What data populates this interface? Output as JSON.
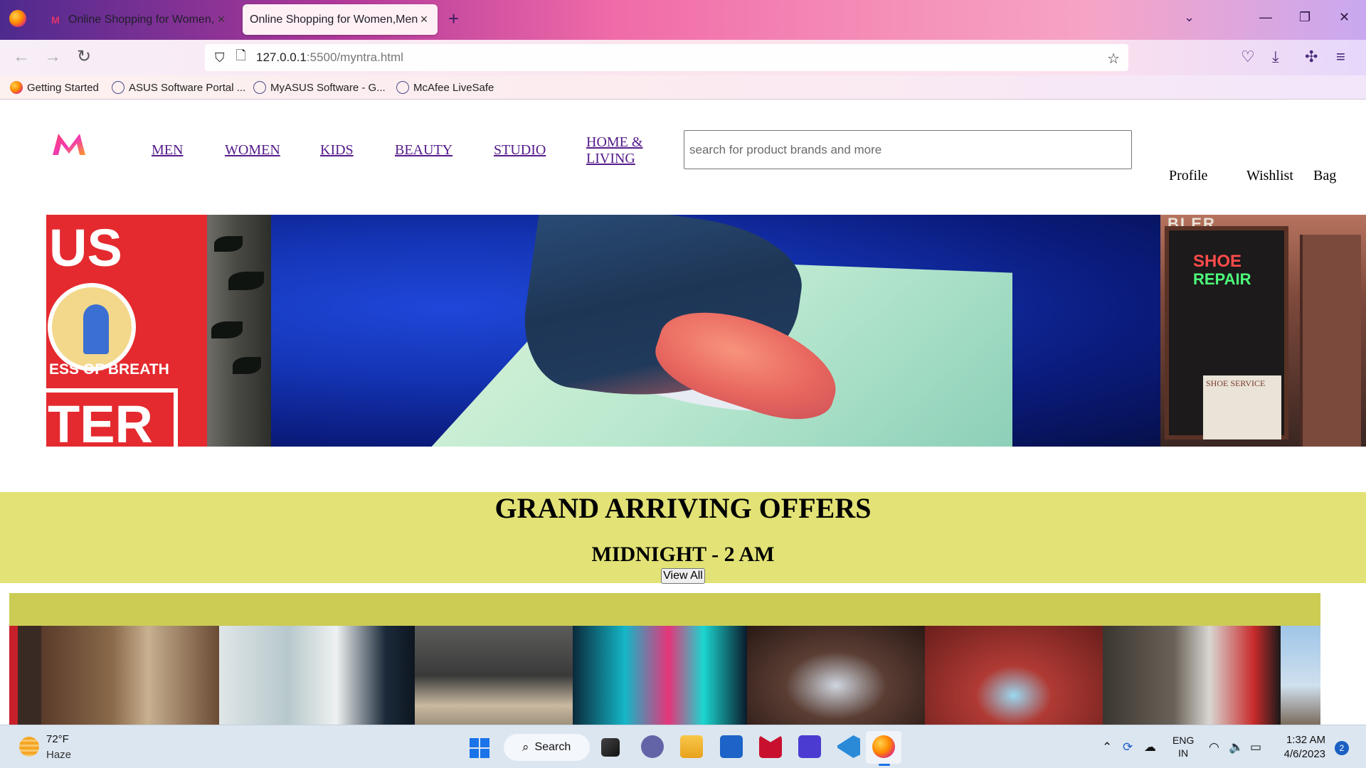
{
  "browser": {
    "tabs": [
      {
        "title": "Online Shopping for Women, M",
        "close": "×"
      },
      {
        "title": "Online Shopping for Women,Men,K",
        "close": "×"
      }
    ],
    "new_tab": "+",
    "list_tabs": "⌄",
    "window_controls": {
      "minimize": "—",
      "restore": "❐",
      "close": "✕"
    },
    "url": {
      "host": "127.0.0.1",
      "rest": ":5500/myntra.html"
    },
    "bookmarks": [
      "Getting Started",
      "ASUS Software Portal ...",
      "MyASUS Software - G...",
      "McAfee LiveSafe"
    ]
  },
  "site": {
    "nav": [
      "MEN",
      "WOMEN",
      "KIDS",
      "BEAUTY",
      "STUDIO",
      "HOME &",
      "LIVING"
    ],
    "search_placeholder": "search for product brands and more",
    "user_actions": {
      "profile": "Profile",
      "wishlist": "Wishlist",
      "bag": "Bag"
    },
    "hero": {
      "left_sign_top": "US",
      "left_sign_mid": "ESS OF BREATH",
      "left_sign_bottom": "TER",
      "right_neon_1": "SHOE",
      "right_neon_2": "REPAIR",
      "right_top": "BLER",
      "right_sign": "SHOE SERVICE"
    },
    "offers": {
      "title": "GRAND ARRIVING OFFERS",
      "subtitle": "MIDNIGHT - 2 AM",
      "button": "View All"
    },
    "brand_color": "#e3346b",
    "offer_band_color": "#e2e276"
  },
  "taskbar": {
    "weather": {
      "temp": "72°F",
      "condition": "Haze"
    },
    "search_label": "Search",
    "language": {
      "line1": "ENG",
      "line2": "IN"
    },
    "clock": {
      "time": "1:32 AM",
      "date": "4/6/2023"
    },
    "notifications": "2"
  }
}
